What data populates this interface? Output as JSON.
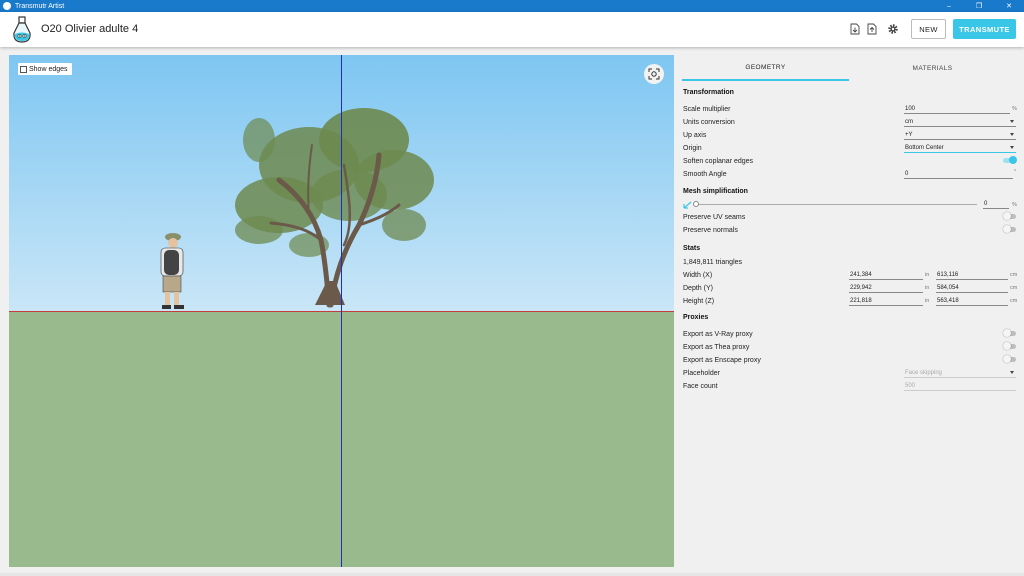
{
  "window": {
    "app_title": "Transmutr Artist",
    "minimize": "–",
    "maximize": "❐",
    "close": "✕"
  },
  "header": {
    "project_title": "O20 Olivier adulte 4",
    "new_label": "NEW",
    "transmute_label": "TRANSMUTE",
    "icons": [
      "import-file-icon",
      "export-file-icon",
      "gear-icon"
    ]
  },
  "viewport": {
    "show_edges_label": "Show edges",
    "show_edges_checked": false,
    "colors": {
      "sky_top": "#7ec6f2",
      "ground": "#99ba8c",
      "horizon": "#c83b3b",
      "axis": "#1c2fc0"
    }
  },
  "tabs": [
    {
      "label": "GEOMETRY",
      "active": true
    },
    {
      "label": "MATERIALS",
      "active": false
    }
  ],
  "transformation": {
    "heading": "Transformation",
    "scale_label": "Scale multiplier",
    "scale_value": "100",
    "scale_unit": "%",
    "units_label": "Units conversion",
    "units_value": "cm",
    "upaxis_label": "Up axis",
    "upaxis_value": "+Y",
    "origin_label": "Origin",
    "origin_value": "Bottom Center",
    "soften_label": "Soften coplanar edges",
    "soften_on": true,
    "smooth_label": "Smooth Angle",
    "smooth_value": "0",
    "smooth_unit": "°"
  },
  "mesh": {
    "heading": "Mesh simplification",
    "value": "0",
    "unit": "%",
    "uv_label": "Preserve UV seams",
    "uv_on": false,
    "normals_label": "Preserve normals",
    "normals_on": false
  },
  "stats": {
    "heading": "Stats",
    "triangles": "1,849,811 triangles",
    "width_label": "Width (X)",
    "width_in": "241,384",
    "width_cm": "613,116",
    "depth_label": "Depth (Y)",
    "depth_in": "229,942",
    "depth_cm": "584,054",
    "height_label": "Height (Z)",
    "height_in": "221,818",
    "height_cm": "563,418",
    "unit_in": "in",
    "unit_cm": "cm"
  },
  "proxies": {
    "heading": "Proxies",
    "vray_label": "Export as V-Ray proxy",
    "vray_on": false,
    "thea_label": "Export as Thea proxy",
    "thea_on": false,
    "enscape_label": "Export as Enscape proxy",
    "enscape_on": false,
    "placeholder_label": "Placeholder",
    "placeholder_value": "Face skipping",
    "facecount_label": "Face count",
    "facecount_value": "500"
  },
  "accent_color": "#3ac6e6"
}
